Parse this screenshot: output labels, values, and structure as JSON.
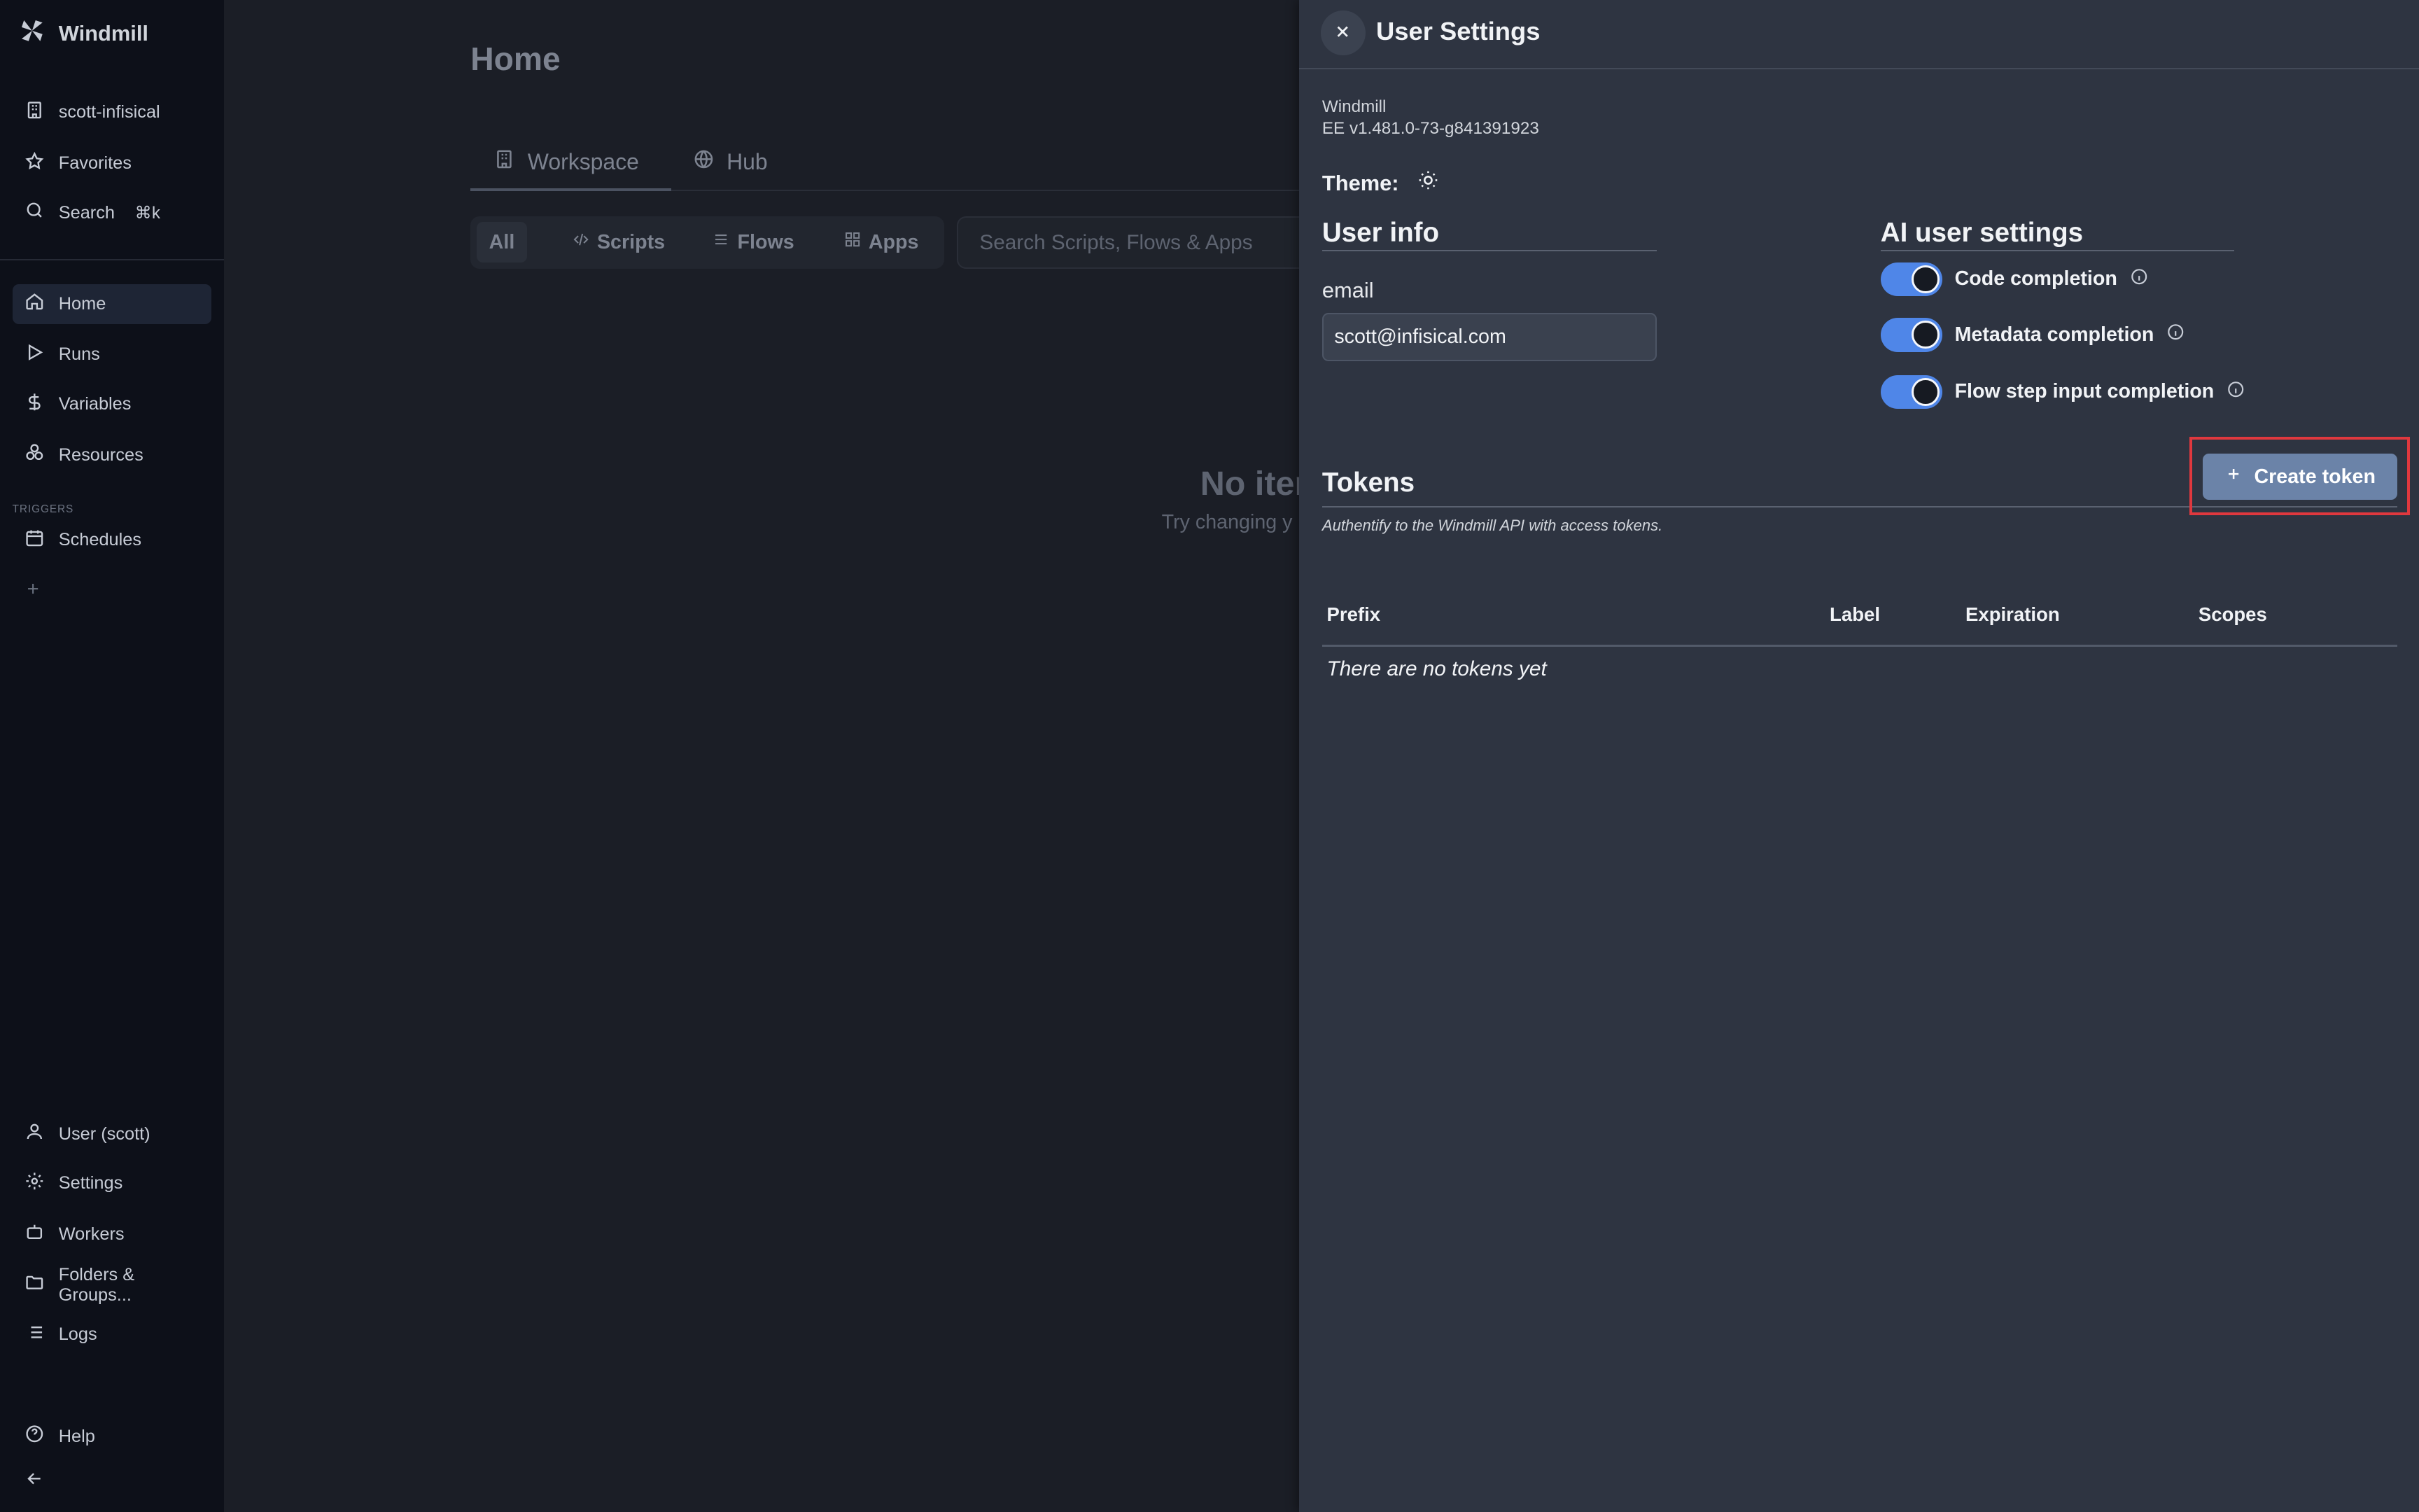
{
  "brand": {
    "name": "Windmill"
  },
  "sidebar": {
    "top": [
      {
        "label": "scott-infisical",
        "icon": "building-icon"
      },
      {
        "label": "Favorites",
        "icon": "star-icon"
      },
      {
        "label": "Search",
        "shortcut": "⌘k",
        "icon": "search-icon"
      }
    ],
    "nav": [
      {
        "label": "Home",
        "icon": "home-icon",
        "active": true
      },
      {
        "label": "Runs",
        "icon": "play-icon"
      },
      {
        "label": "Variables",
        "icon": "dollar-icon"
      },
      {
        "label": "Resources",
        "icon": "boxes-icon"
      }
    ],
    "triggers_heading": "TRIGGERS",
    "triggers": [
      {
        "label": "Schedules",
        "icon": "calendar-icon"
      }
    ],
    "bottom": [
      {
        "label": "User (scott)",
        "icon": "user-icon"
      },
      {
        "label": "Settings",
        "icon": "gear-icon"
      },
      {
        "label": "Workers",
        "icon": "bot-icon"
      },
      {
        "label": "Folders & Groups...",
        "icon": "folder-icon"
      },
      {
        "label": "Logs",
        "icon": "list-icon"
      }
    ],
    "help": "Help"
  },
  "main": {
    "title": "Home",
    "tabs": [
      {
        "label": "Workspace",
        "icon": "building-icon",
        "active": true
      },
      {
        "label": "Hub",
        "icon": "globe-icon"
      }
    ],
    "filters": [
      {
        "label": "All",
        "selected": true
      },
      {
        "label": "Scripts",
        "icon": "code-icon"
      },
      {
        "label": "Flows",
        "icon": "flow-icon"
      },
      {
        "label": "Apps",
        "icon": "grid-icon"
      }
    ],
    "search_placeholder": "Search Scripts, Flows & Apps",
    "empty_title": "No iter",
    "empty_sub": "Try changing y"
  },
  "drawer": {
    "title": "User Settings",
    "app_name": "Windmill",
    "version": "EE v1.481.0-73-g841391923",
    "theme_label": "Theme:",
    "user_info": {
      "title": "User info",
      "email_label": "email",
      "email_value": "scott@infisical.com"
    },
    "ai": {
      "title": "AI user settings",
      "items": [
        {
          "label": "Code completion",
          "on": true
        },
        {
          "label": "Metadata completion",
          "on": true
        },
        {
          "label": "Flow step input completion",
          "on": true
        }
      ]
    },
    "tokens": {
      "title": "Tokens",
      "create_label": "Create token",
      "description": "Authentify to the Windmill API with access tokens.",
      "columns": [
        "Prefix",
        "Label",
        "Expiration",
        "Scopes"
      ],
      "empty_text": "There are no tokens yet"
    }
  },
  "colors": {
    "accent": "#4f86e8",
    "highlight": "#e0383e",
    "drawer_bg": "#2e3441",
    "sidebar_bg": "#0d1019"
  }
}
